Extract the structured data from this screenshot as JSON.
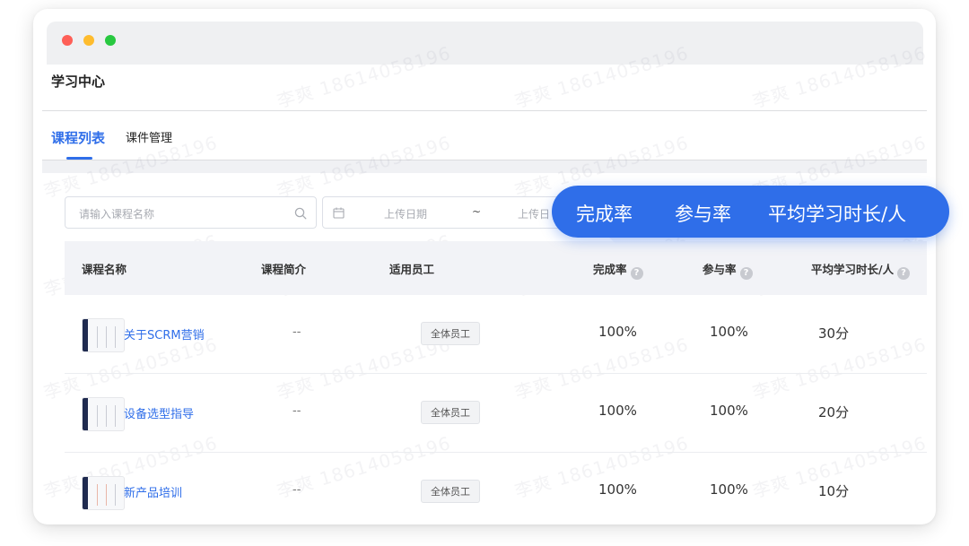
{
  "app": {
    "title": "学习中心"
  },
  "tabs": [
    {
      "label": "课程列表",
      "active": true
    },
    {
      "label": "课件管理",
      "active": false
    }
  ],
  "filters": {
    "search_placeholder": "请输入课程名称",
    "date_start_placeholder": "上传日期",
    "date_separator": "~",
    "date_end_placeholder": "上传日"
  },
  "table": {
    "headers": [
      "课程名称",
      "课程简介",
      "适用员工",
      "完成率",
      "参与率",
      "平均学习时长/人"
    ],
    "rows": [
      {
        "name": "关于SCRM营销",
        "intro": "--",
        "audience": "全体员工",
        "completion": "100%",
        "participation": "100%",
        "avg_time": "30分"
      },
      {
        "name": "设备选型指导",
        "intro": "--",
        "audience": "全体员工",
        "completion": "100%",
        "participation": "100%",
        "avg_time": "20分"
      },
      {
        "name": "新产品培训",
        "intro": "--",
        "audience": "全体员工",
        "completion": "100%",
        "participation": "100%",
        "avg_time": "10分"
      }
    ]
  },
  "callout": {
    "metrics": [
      "完成率",
      "参与率",
      "平均学习时长/人"
    ]
  },
  "watermark": "李爽 18614058196",
  "colors": {
    "accent": "#2f6ee9",
    "titlebar": "#eff0f2",
    "header_bg": "#f2f3f7"
  },
  "icons": {
    "search": "search-icon",
    "calendar": "calendar-icon",
    "help": "question-icon"
  }
}
